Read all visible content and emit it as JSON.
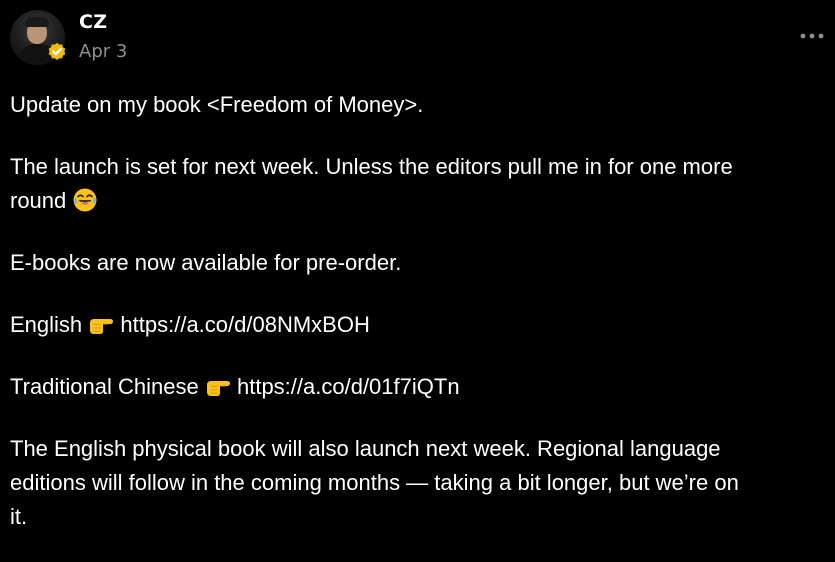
{
  "author": {
    "name": "CZ",
    "date": "Apr 3",
    "avatar_icon": "avatar-photo",
    "badge_icon": "verified-badge-icon",
    "badge_color": "#f0b90b"
  },
  "menu": {
    "icon": "more-options-icon"
  },
  "post": {
    "p1": "Update on my book <Freedom of Money>.",
    "p2_line1": "The launch is set for next week. Unless the editors pull me in for one more",
    "p2_line2": "round",
    "p3": "E-books are now available for pre-order.",
    "english_label": "English",
    "english_link": "https://a.co/d/08NMxBOH",
    "chinese_label": "Traditional Chinese",
    "chinese_link": "https://a.co/d/01f7iQTn",
    "p6_line1": "The English physical book will also launch next week. Regional language",
    "p6_line2": "editions will follow in the coming months — taking a bit longer, but we’re on",
    "p6_line3": "it."
  },
  "emojis": {
    "laughing": "face-with-tears-of-joy-emoji",
    "pointing": "backhand-index-pointing-right-emoji"
  }
}
